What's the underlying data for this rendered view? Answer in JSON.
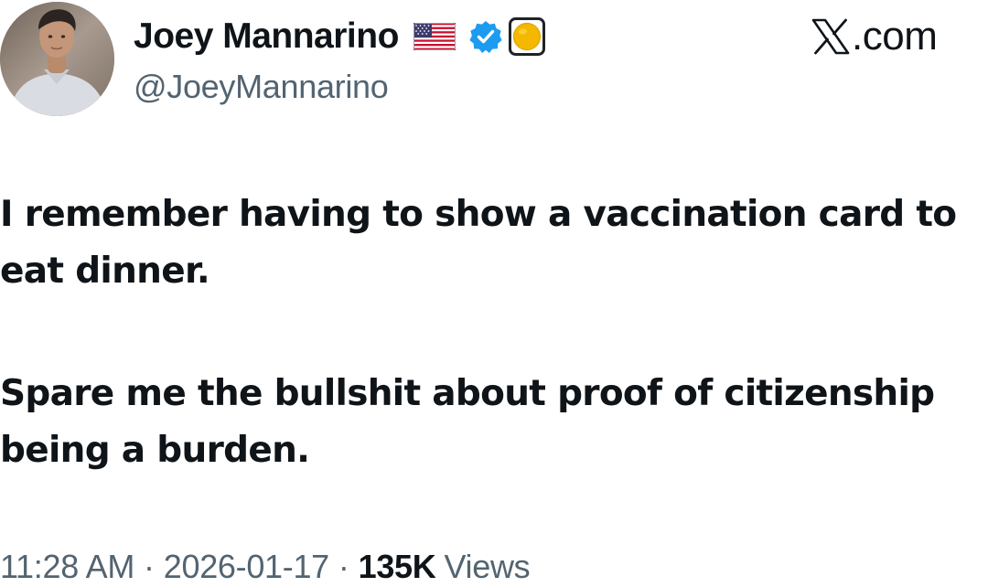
{
  "author": {
    "display_name": "Joey Mannarino",
    "handle": "@JoeyMannarino",
    "avatar": "profile-photo",
    "badges": [
      "us-flag-emoji",
      "verified-badge",
      "affiliate-badge"
    ]
  },
  "brand": {
    "logo": "x-logo-icon",
    "domain": ".com"
  },
  "tweet": {
    "paragraphs": [
      "I remember having to show a vaccination card to eat dinner.",
      "Spare me the bullshit about proof of citizenship being a burden."
    ]
  },
  "meta": {
    "time": "11:28 AM",
    "separator": "·",
    "date": "2026-01-17",
    "views_count": "135K",
    "views_label": "Views"
  },
  "colors": {
    "text_primary": "#0f1419",
    "text_secondary": "#536471",
    "verified_blue": "#1d9bf0",
    "affiliate_gold": "#f5b800"
  }
}
